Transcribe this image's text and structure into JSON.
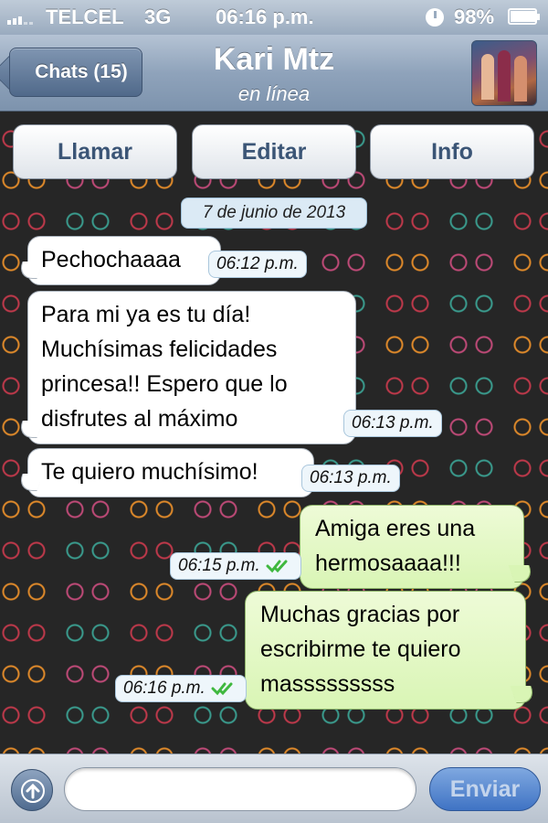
{
  "status_bar": {
    "carrier": "TELCEL",
    "network": "3G",
    "time": "06:16 p.m.",
    "battery": "98%",
    "icons": [
      "signal-icon",
      "clock-icon",
      "battery-charging-icon"
    ]
  },
  "header": {
    "back_label": "Chats (15)",
    "contact_name": "Kari Mtz",
    "contact_status": "en línea",
    "avatar_icon": "contact-photo"
  },
  "actions": {
    "call": "Llamar",
    "edit": "Editar",
    "info": "Info"
  },
  "chat": {
    "date": "7 de junio de 2013",
    "messages": [
      {
        "direction": "incoming",
        "text": "Pechochaaaa",
        "time": "06:12 p.m."
      },
      {
        "direction": "incoming",
        "text": "Para mi ya es tu día!\nMuchísimas felicidades\nprincesa!! Espero que lo\ndisfrutes al máximo",
        "time": "06:13 p.m."
      },
      {
        "direction": "incoming",
        "text": "Te quiero muchísimo!",
        "time": "06:13 p.m."
      },
      {
        "direction": "outgoing",
        "text": "Amiga eres una\nhermosaaaa!!!",
        "time": "06:15 p.m.",
        "read": true
      },
      {
        "direction": "outgoing",
        "text": "Muchas gracias por\nescribirme te quiero\nmasssssssss",
        "time": "06:16 p.m.",
        "read": true
      }
    ]
  },
  "composer": {
    "input_value": "",
    "send_label": "Enviar",
    "attach_icon": "upload-arrow-icon"
  },
  "colors": {
    "incoming_bubble": "#ffffff",
    "outgoing_bubble": "#dcf8c6",
    "nav_bar": "#8fa3bb",
    "read_ticks": "#3fb83f",
    "send_button": "#3f73c4"
  }
}
